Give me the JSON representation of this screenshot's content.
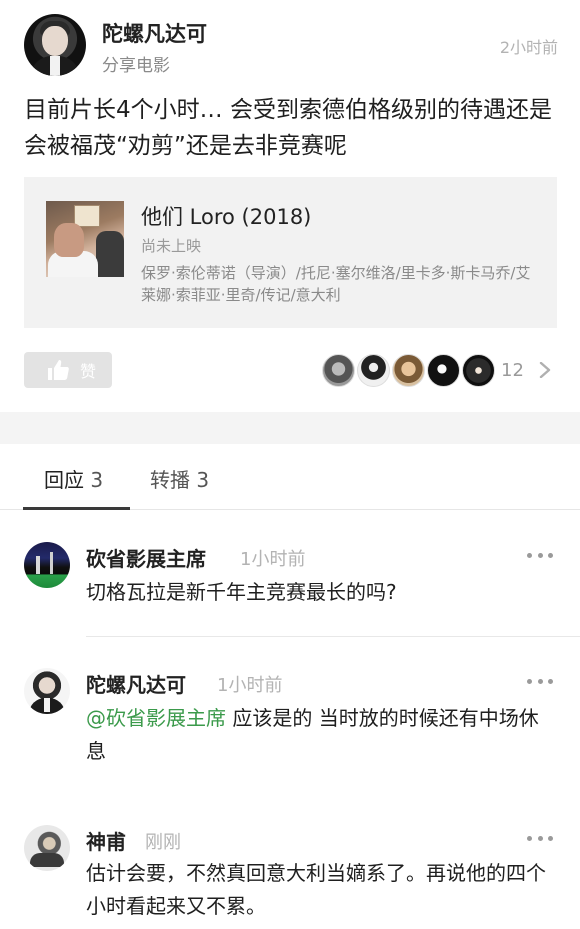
{
  "post": {
    "author_name": "陀螺凡达可",
    "author_sub": "分享电影",
    "time": "2小时前",
    "text": "目前片长4个小时… 会受到索德伯格级别的待遇还是会被福茂“劝剪”还是去非竞赛呢"
  },
  "movie": {
    "title": "他们 Loro (2018)",
    "status": "尚未上映",
    "meta": "保罗·索伦蒂诺（导演）/托尼·塞尔维洛/里卡多·斯卡马乔/艾莱娜·索菲亚·里奇/传记/意大利"
  },
  "actions": {
    "like_label": "赞",
    "like_count": "12"
  },
  "tabs": {
    "replies_label": "回应",
    "replies_count": "3",
    "reposts_label": "转播",
    "reposts_count": "3"
  },
  "comments": [
    {
      "name": "砍省影展主席",
      "time": "1小时前",
      "text": "切格瓦拉是新千年主竞赛最长的吗?"
    },
    {
      "name": "陀螺凡达可",
      "time": "1小时前",
      "mention": "@砍省影展主席",
      "text": " 应该是的 当时放的时候还有中场休息"
    },
    {
      "name": "神甫",
      "time": "刚刚",
      "text": "估计会要，不然真回意大利当嫡系了。再说他的四个小时看起来又不累。"
    }
  ]
}
